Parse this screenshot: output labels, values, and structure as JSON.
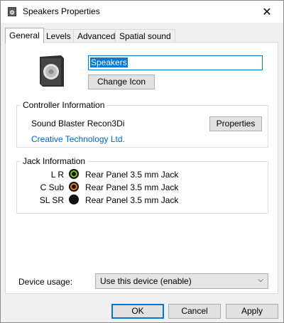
{
  "window": {
    "title": "Speakers Properties",
    "close_glyph": "✕",
    "title_icon": "speaker-small-icon"
  },
  "tabs": [
    {
      "label": "General",
      "active": true
    },
    {
      "label": "Levels",
      "active": false
    },
    {
      "label": "Advanced",
      "active": false
    },
    {
      "label": "Spatial sound",
      "active": false
    }
  ],
  "device": {
    "icon": "speaker-device-icon",
    "name_value": "Speakers",
    "change_icon_label": "Change Icon"
  },
  "controller": {
    "group_label": "Controller Information",
    "name": "Sound Blaster Recon3Di",
    "vendor": "Creative Technology Ltd.",
    "properties_label": "Properties"
  },
  "jack": {
    "group_label": "Jack Information",
    "rows": [
      {
        "label": "L R",
        "color": "#7cbf2a",
        "text": "Rear Panel 3.5 mm Jack"
      },
      {
        "label": "C Sub",
        "color": "#e87a1e",
        "text": "Rear Panel 3.5 mm Jack"
      },
      {
        "label": "SL SR",
        "color": "#111111",
        "text": "Rear Panel 3.5 mm Jack"
      }
    ]
  },
  "usage": {
    "label": "Device usage:",
    "selected": "Use this device (enable)",
    "chevron": "⌵"
  },
  "footer": {
    "ok_label": "OK",
    "cancel_label": "Cancel",
    "apply_label": "Apply"
  },
  "colors": {
    "accent": "#0078d7",
    "link": "#0066cc"
  }
}
